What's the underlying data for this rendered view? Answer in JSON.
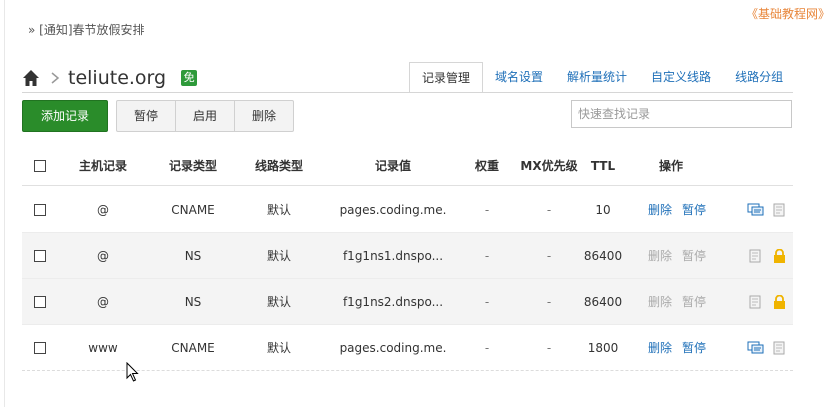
{
  "notice": "» [通知]春节放假安排",
  "watermark": "《基础教程网》",
  "domain": {
    "name": "teliute.org",
    "badge": "免"
  },
  "tabs": [
    "记录管理",
    "域名设置",
    "解析量统计",
    "自定义线路",
    "线路分组"
  ],
  "toolbar": {
    "add": "添加记录",
    "pause": "暂停",
    "enable": "启用",
    "delete": "删除"
  },
  "search": {
    "placeholder": "快速查找记录"
  },
  "table": {
    "headers": {
      "host": "主机记录",
      "type": "记录类型",
      "line": "线路类型",
      "value": "记录值",
      "weight": "权重",
      "mx": "MX优先级",
      "ttl": "TTL",
      "ops": "操作"
    },
    "rows": [
      {
        "host": "@",
        "type": "CNAME",
        "line": "默认",
        "value": "pages.coding.me.",
        "weight": "-",
        "mx": "-",
        "ttl": "10",
        "delete": "删除",
        "pause": "暂停",
        "locked": false
      },
      {
        "host": "@",
        "type": "NS",
        "line": "默认",
        "value": "f1g1ns1.dnspo...",
        "weight": "-",
        "mx": "-",
        "ttl": "86400",
        "delete": "删除",
        "pause": "暂停",
        "locked": true
      },
      {
        "host": "@",
        "type": "NS",
        "line": "默认",
        "value": "f1g1ns2.dnspo...",
        "weight": "-",
        "mx": "-",
        "ttl": "86400",
        "delete": "删除",
        "pause": "暂停",
        "locked": true
      },
      {
        "host": "www",
        "type": "CNAME",
        "line": "默认",
        "value": "pages.coding.me.",
        "weight": "-",
        "mx": "-",
        "ttl": "1800",
        "delete": "删除",
        "pause": "暂停",
        "locked": false
      }
    ]
  },
  "colors": {
    "primary_green": "#2a8c2a",
    "link_blue": "#1e6fb8",
    "lock_yellow": "#f0b400",
    "badge_green": "#2e9a3a"
  }
}
